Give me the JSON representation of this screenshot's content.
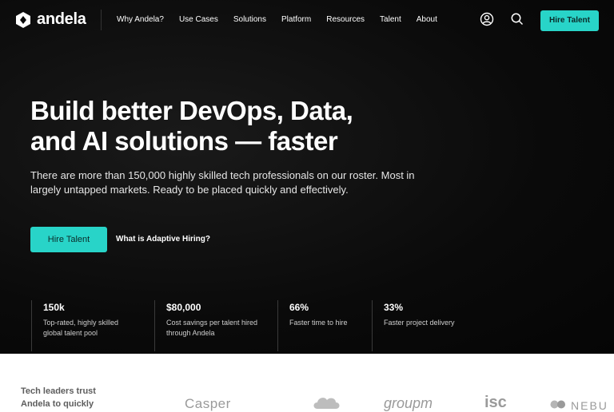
{
  "brand": {
    "name": "andela"
  },
  "nav": {
    "items": [
      "Why Andela?",
      "Use Cases",
      "Solutions",
      "Platform",
      "Resources",
      "Talent",
      "About"
    ],
    "cta": "Hire Talent",
    "icons": [
      "user-icon",
      "search-icon"
    ]
  },
  "hero": {
    "title_line1": "Build better DevOps, Data,",
    "title_line2": "and AI solutions — faster",
    "subtitle": "There are more than 150,000 highly skilled tech professionals on our roster. Most in largely untapped markets. Ready to be placed quickly and effectively.",
    "cta": "Hire Talent",
    "link": "What is Adaptive Hiring?"
  },
  "stats": [
    {
      "value": "150k",
      "desc": "Top-rated, highly skilled global talent pool"
    },
    {
      "value": "$80,000",
      "desc": "Cost savings per talent hired through Andela"
    },
    {
      "value": "66%",
      "desc": "Faster time to hire"
    },
    {
      "value": "33%",
      "desc": "Faster project delivery"
    }
  ],
  "trust": {
    "text": "Tech leaders trust Andela to quickly",
    "logos": [
      "Casper",
      "groupm",
      "isc",
      "NEBU"
    ]
  },
  "colors": {
    "accent": "#28d4c8",
    "hero_bg": "#0a0a0a"
  }
}
